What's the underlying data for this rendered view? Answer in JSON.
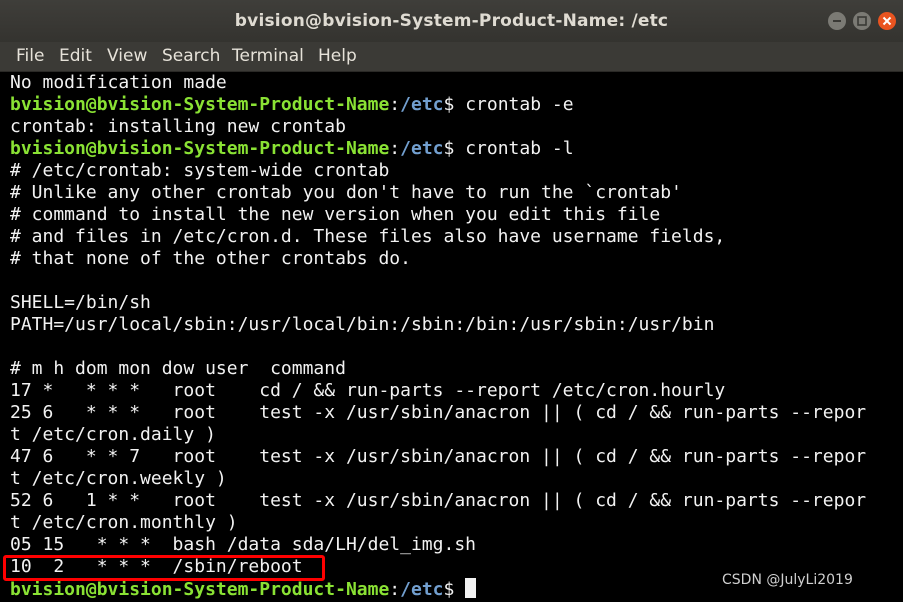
{
  "window": {
    "title": "bvision@bvision-System-Product-Name: /etc"
  },
  "menu": {
    "items": [
      "File",
      "Edit",
      "View",
      "Search",
      "Terminal",
      "Help"
    ]
  },
  "prompt": {
    "user": "bvision@bvision-System-Product-Name",
    "sep": ":",
    "path": "/etc",
    "sym": "$ "
  },
  "terminal": {
    "l0": "No modification made",
    "cmd1": "crontab -e",
    "l2": "crontab: installing new crontab",
    "cmd2": "crontab -l",
    "l4": "# /etc/crontab: system-wide crontab",
    "l5": "# Unlike any other crontab you don't have to run the `crontab'",
    "l6": "# command to install the new version when you edit this file",
    "l7": "# and files in /etc/cron.d. These files also have username fields,",
    "l8": "# that none of the other crontabs do.",
    "l10": "SHELL=/bin/sh",
    "l11": "PATH=/usr/local/sbin:/usr/local/bin:/sbin:/bin:/usr/sbin:/usr/bin",
    "l13": "# m h dom mon dow user  command",
    "l14": "17 *   * * *   root    cd / && run-parts --report /etc/cron.hourly",
    "l15": "25 6   * * *   root    test -x /usr/sbin/anacron || ( cd / && run-parts --repor",
    "l16": "t /etc/cron.daily )",
    "l17": "47 6   * * 7   root    test -x /usr/sbin/anacron || ( cd / && run-parts --repor",
    "l18": "t /etc/cron.weekly )",
    "l19": "52 6   1 * *   root    test -x /usr/sbin/anacron || ( cd / && run-parts --repor",
    "l20": "t /etc/cron.monthly )",
    "l21": "05 15   * * *  bash /data sda/LH/del_img.sh",
    "l22": "10  2   * * *  /sbin/reboot"
  },
  "watermark": "CSDN @JulyLi2019",
  "colors": {
    "prompt_user": "#8ae234",
    "prompt_path": "#729fcf",
    "highlight": "#ff0000",
    "close_button": "#e95420"
  }
}
